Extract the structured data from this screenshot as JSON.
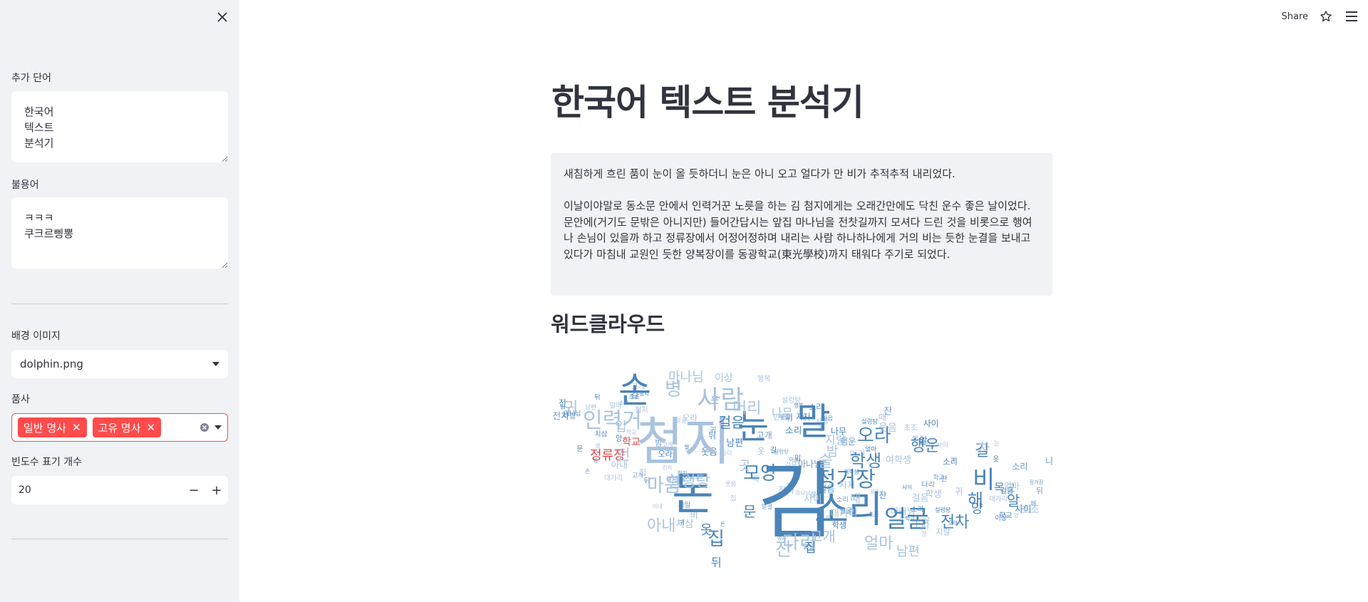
{
  "sidebar": {
    "extra_words_label": "추가 단어",
    "extra_words_value": "한국어\n텍스트\n분석기",
    "stopwords_label": "불용어",
    "stopwords_value": "ㅋㅋㅋ\n쿠크르삥뽕",
    "background_image_label": "배경 이미지",
    "background_image_value": "dolphin.png",
    "pos_label": "품사",
    "pos_tags": [
      "일반 명사",
      "고유 명사"
    ],
    "freq_count_label": "빈도수 표기 개수",
    "freq_count_value": "20"
  },
  "header": {
    "share_label": "Share"
  },
  "main": {
    "title": "한국어 텍스트 분석기",
    "text_paragraphs": [
      "새침하게 흐린 품이 눈이 올 듯하더니 눈은 아니 오고 얼다가 만 비가 추적추적 내리었다.",
      "이날이야말로 동소문 안에서 인력거꾼 노릇을 하는 김 첨지에게는 오래간만에도 닥친 운수 좋은 날이었다. 문안에(거기도 문밖은 아니지만) 들어간답시는 앞집 마나님을 전찻길까지 모셔다 드린 것을 비롯으로 행여나 손님이 있을까 하고 정류장에서 어정어정하며 내리는 사람 하나하나에게 거의 비는 듯한 눈결을 보내고 있다가 마침내 교원인 듯한 양복장이를 동광학교(東光學校)까지 태워다 주기로 되었다."
    ],
    "wordcloud_heading": "워드클라우드"
  },
  "wordcloud_words": [
    {
      "text": "김"
    },
    {
      "text": "첨지"
    },
    {
      "text": "돈"
    },
    {
      "text": "눈"
    },
    {
      "text": "말"
    },
    {
      "text": "소리"
    },
    {
      "text": "손"
    },
    {
      "text": "사람"
    },
    {
      "text": "병"
    },
    {
      "text": "인력거"
    },
    {
      "text": "얼굴"
    },
    {
      "text": "정거장"
    },
    {
      "text": "비"
    },
    {
      "text": "모양"
    },
    {
      "text": "설렁탕"
    },
    {
      "text": "마음"
    },
    {
      "text": "오라"
    },
    {
      "text": "행운"
    },
    {
      "text": "학생"
    },
    {
      "text": "술"
    },
    {
      "text": "머리"
    },
    {
      "text": "걸음"
    },
    {
      "text": "집"
    },
    {
      "text": "다리"
    },
    {
      "text": "전차"
    },
    {
      "text": "아내"
    },
    {
      "text": "마나님"
    },
    {
      "text": "이상"
    },
    {
      "text": "정류장"
    },
    {
      "text": "귀"
    },
    {
      "text": "고개"
    },
    {
      "text": "길"
    },
    {
      "text": "차"
    },
    {
      "text": "해"
    },
    {
      "text": "양"
    },
    {
      "text": "얼마"
    },
    {
      "text": "남편"
    },
    {
      "text": "목"
    },
    {
      "text": "알"
    },
    {
      "text": "문"
    },
    {
      "text": "학교"
    },
    {
      "text": "전"
    },
    {
      "text": "초조"
    },
    {
      "text": "잔"
    },
    {
      "text": "입"
    },
    {
      "text": "뒤"
    },
    {
      "text": "대가리"
    },
    {
      "text": "옷"
    },
    {
      "text": "밤"
    },
    {
      "text": "곳"
    },
    {
      "text": "나무"
    },
    {
      "text": "지랄"
    },
    {
      "text": "웃음"
    },
    {
      "text": "여학생"
    },
    {
      "text": "때"
    },
    {
      "text": "사이"
    },
    {
      "text": "자지"
    },
    {
      "text": "치삼"
    },
    {
      "text": "행복"
    },
    {
      "text": "집"
    }
  ],
  "colors": {
    "sidebar_bg": "#f0f2f6",
    "accent": "#ff4b4b",
    "text": "#31333f",
    "wc_blue_dark": "#4a84b8",
    "wc_blue": "#6f9ccc",
    "wc_blue_light": "#a9c3df",
    "wc_red": "#d9474a"
  },
  "icons": {
    "close": "close-icon",
    "star": "star-icon",
    "menu": "hamburger-menu-icon",
    "select_arrow": "caret-down-icon",
    "clear": "clear-circle-icon"
  }
}
